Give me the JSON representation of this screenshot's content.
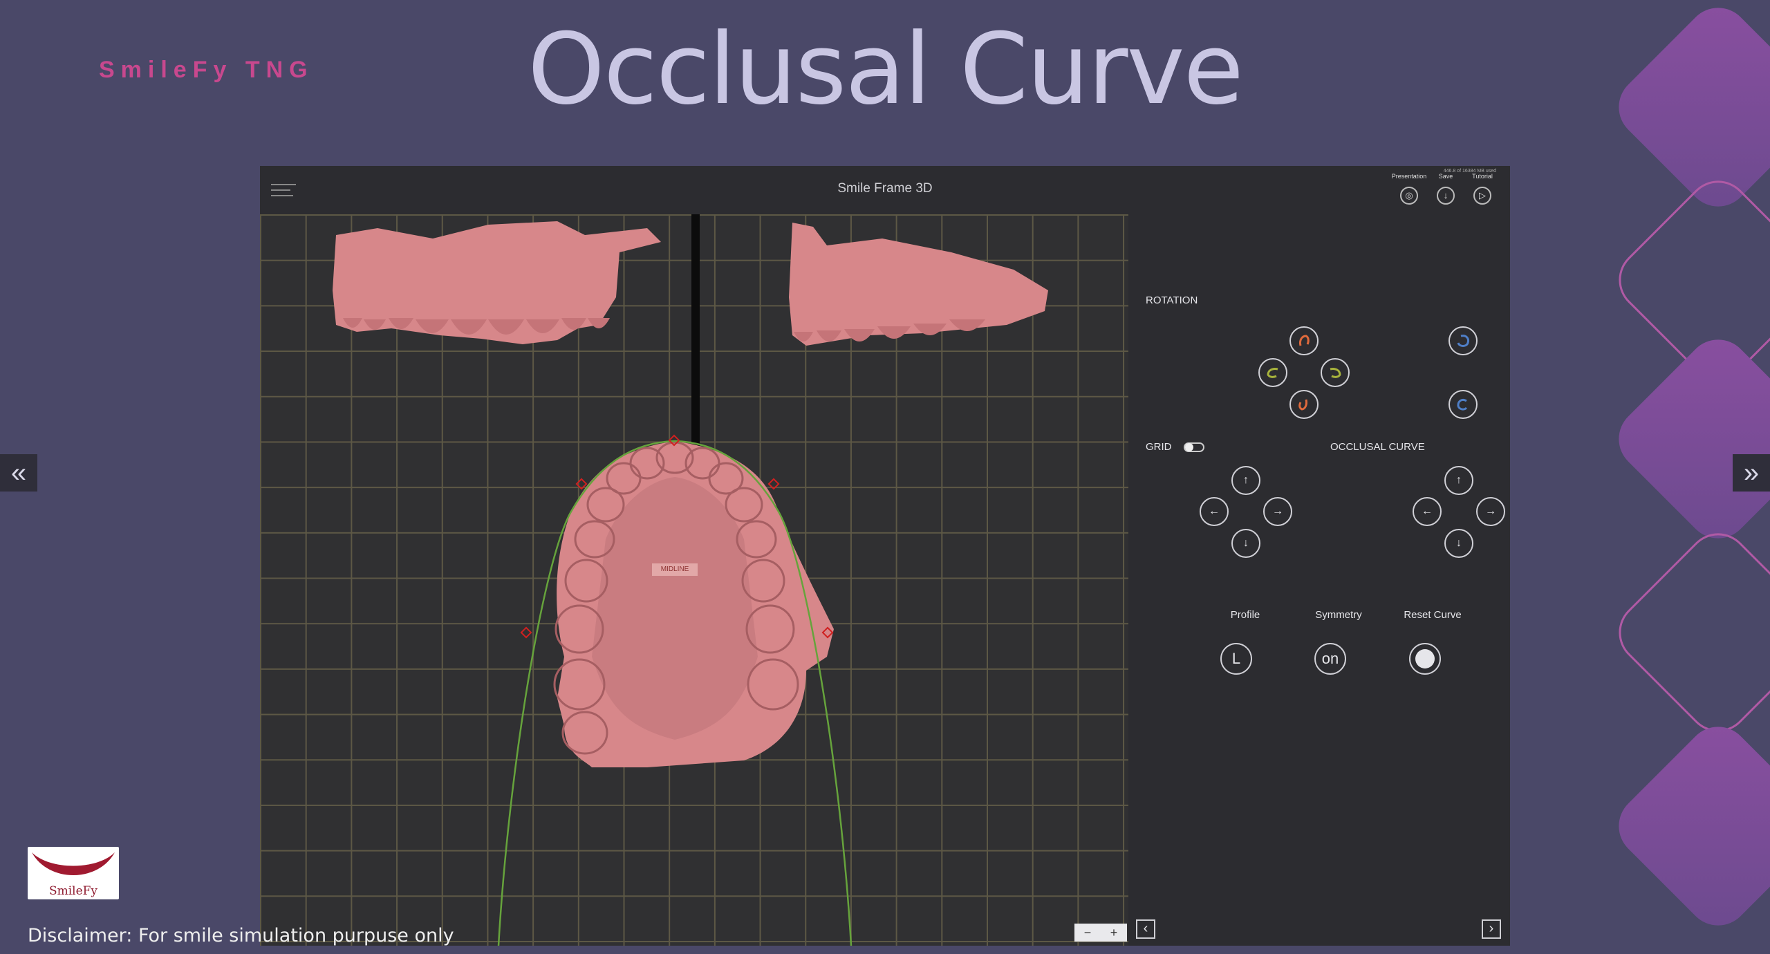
{
  "brand": "SmileFy TNG",
  "page_title": "Occlusal Curve",
  "nav": {
    "prev_icon": "double-chevron-left",
    "next_icon": "double-chevron-right"
  },
  "app": {
    "title": "Smile Frame 3D",
    "memory_text": "446.8 of 16384 MB used",
    "toolbar": {
      "presentation": "Presentation",
      "save": "Save",
      "tutorial": "Tutorial"
    },
    "viewport": {
      "midline_label": "MIDLINE"
    },
    "panel": {
      "rotation_label": "ROTATION",
      "grid_label": "GRID",
      "occlusal_curve_label": "OCCLUSAL CURVE",
      "grid_toggle_on": false,
      "profile_label": "Profile",
      "profile_value": "L",
      "symmetry_label": "Symmetry",
      "symmetry_value": "on",
      "reset_label": "Reset Curve"
    },
    "zoom": {
      "minus": "−",
      "plus": "+"
    },
    "colors": {
      "model": "#d7878a",
      "curve": "#66a33c",
      "grid": "#5d5845",
      "rot_orange": "#e06a3c",
      "rot_green": "#a8b43c",
      "rot_blue": "#4f7fc8"
    }
  },
  "logo": {
    "text": "SmileFy"
  },
  "disclaimer": "Disclaimer: For smile simulation purpuse only"
}
